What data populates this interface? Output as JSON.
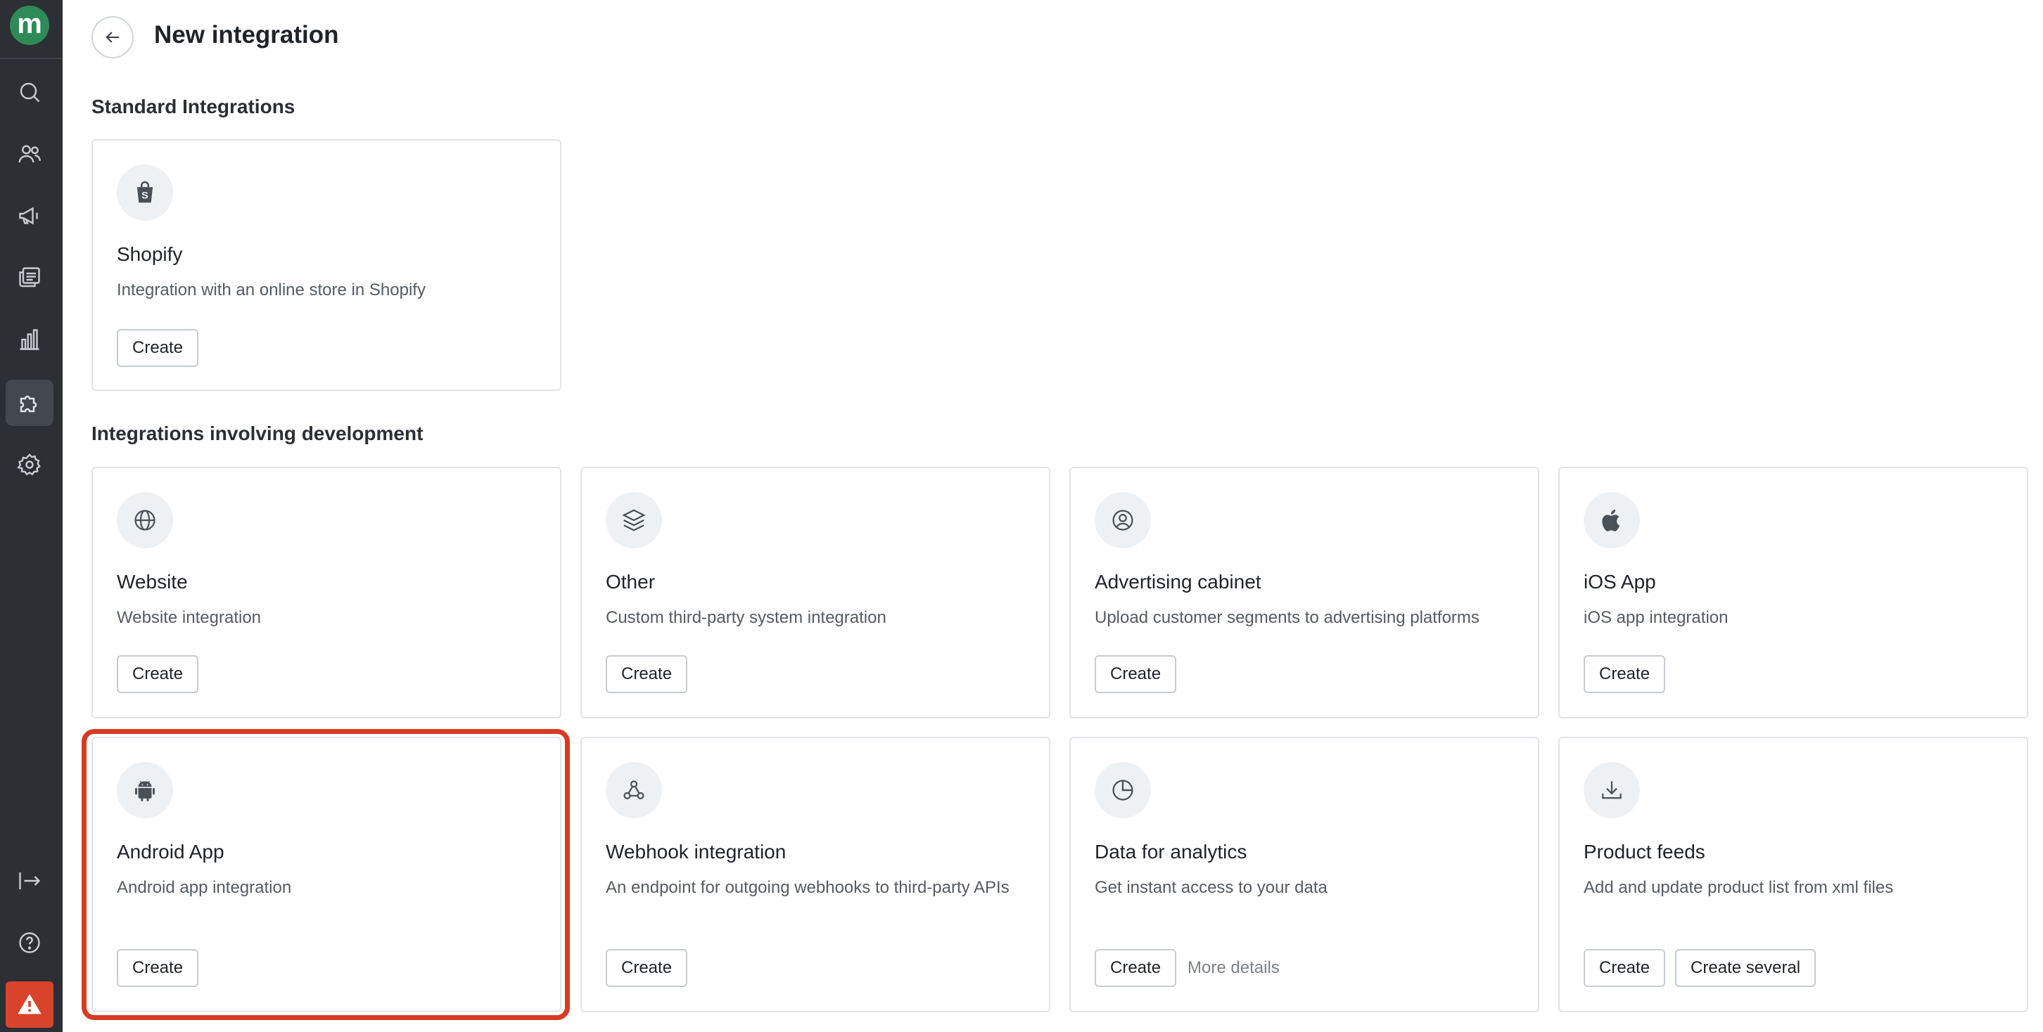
{
  "sidebar": {
    "logo_letter": "m",
    "items": [
      {
        "name": "search-icon"
      },
      {
        "name": "users-icon"
      },
      {
        "name": "megaphone-icon"
      },
      {
        "name": "messages-icon"
      },
      {
        "name": "analytics-icon"
      },
      {
        "name": "puzzle-icon",
        "active": true
      },
      {
        "name": "gear-icon"
      }
    ],
    "bottom": [
      {
        "name": "logout-icon"
      },
      {
        "name": "help-icon"
      },
      {
        "name": "warning-icon"
      }
    ]
  },
  "header": {
    "title": "New integration"
  },
  "sections": {
    "standard": "Standard Integrations",
    "development": "Integrations involving development"
  },
  "cards": {
    "shopify": {
      "title": "Shopify",
      "desc": "Integration with an online store in Shopify",
      "create": "Create"
    },
    "website": {
      "title": "Website",
      "desc": "Website integration",
      "create": "Create"
    },
    "other": {
      "title": "Other",
      "desc": "Custom third-party system integration",
      "create": "Create"
    },
    "advertising": {
      "title": "Advertising cabinet",
      "desc": "Upload customer segments to advertising platforms",
      "create": "Create"
    },
    "ios": {
      "title": "iOS App",
      "desc": "iOS app integration",
      "create": "Create"
    },
    "android": {
      "title": "Android App",
      "desc": "Android app integration",
      "create": "Create"
    },
    "webhook": {
      "title": "Webhook integration",
      "desc": "An endpoint for outgoing webhooks to third-party APIs",
      "create": "Create"
    },
    "analytics": {
      "title": "Data for analytics",
      "desc": "Get instant access to your data",
      "create": "Create",
      "more": "More details"
    },
    "feeds": {
      "title": "Product feeds",
      "desc": "Add and update product list from xml files",
      "create": "Create",
      "create_several": "Create several"
    }
  },
  "colors": {
    "sidebar_bg": "#2c2f34",
    "logo_bg": "#2e8b57",
    "alert_bg": "#d9432b",
    "highlight": "#d93a24"
  }
}
